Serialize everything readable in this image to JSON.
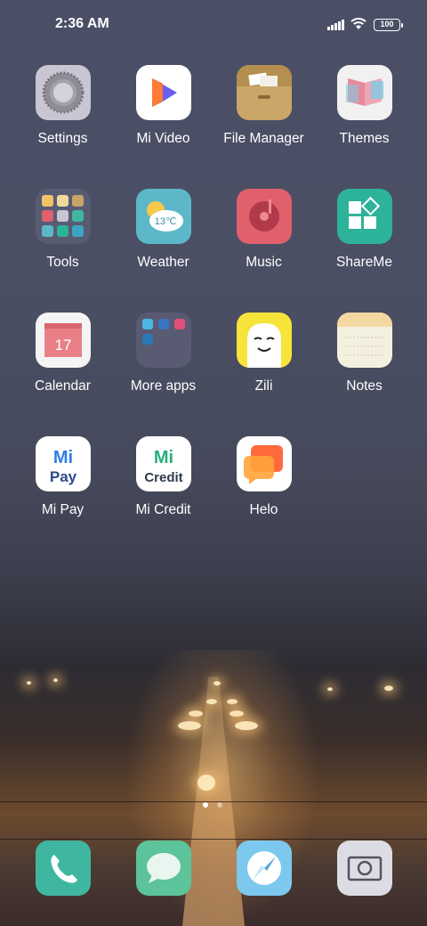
{
  "status_bar": {
    "time": "2:36 AM",
    "battery": "100",
    "icons": [
      "signal-icon",
      "wifi-icon",
      "battery-icon"
    ]
  },
  "apps": [
    {
      "label": "Settings",
      "icon": "settings-icon"
    },
    {
      "label": "Mi Video",
      "icon": "mi-video-icon"
    },
    {
      "label": "File Manager",
      "icon": "file-manager-icon"
    },
    {
      "label": "Themes",
      "icon": "themes-icon"
    },
    {
      "label": "Tools",
      "icon": "tools-folder-icon"
    },
    {
      "label": "Weather",
      "icon": "weather-icon",
      "badge": "13℃"
    },
    {
      "label": "Music",
      "icon": "music-icon"
    },
    {
      "label": "ShareMe",
      "icon": "shareme-icon"
    },
    {
      "label": "Calendar",
      "icon": "calendar-icon",
      "badge": "17"
    },
    {
      "label": "More apps",
      "icon": "more-apps-folder-icon"
    },
    {
      "label": "Zili",
      "icon": "zili-icon"
    },
    {
      "label": "Notes",
      "icon": "notes-icon"
    },
    {
      "label": "Mi Pay",
      "icon": "mi-pay-icon",
      "badge_top": "Mi",
      "badge_bottom": "Pay"
    },
    {
      "label": "Mi Credit",
      "icon": "mi-credit-icon",
      "badge_top": "Mi",
      "badge_bottom": "Credit"
    },
    {
      "label": "Helo",
      "icon": "helo-icon"
    }
  ],
  "dock": [
    {
      "icon": "phone-icon"
    },
    {
      "icon": "messages-icon"
    },
    {
      "icon": "browser-icon"
    },
    {
      "icon": "camera-icon"
    }
  ],
  "page_indicator": {
    "pages": 2,
    "current": 1
  },
  "colors": {
    "settings": "#c9c6d3",
    "file_manager": "#c8a566",
    "themes": "#f1f1f1",
    "weather": "#5cb8c9",
    "music": "#e0606d",
    "shareme": "#2db39a",
    "calendar": "#f4f4f4",
    "zili": "#f7e43a",
    "notes": "#f4f0df",
    "helo": "#ffffff",
    "phone": "#3fb7a0",
    "messages": "#5cc39a",
    "browser": "#7cc8ee",
    "camera": "#dddbe3"
  }
}
